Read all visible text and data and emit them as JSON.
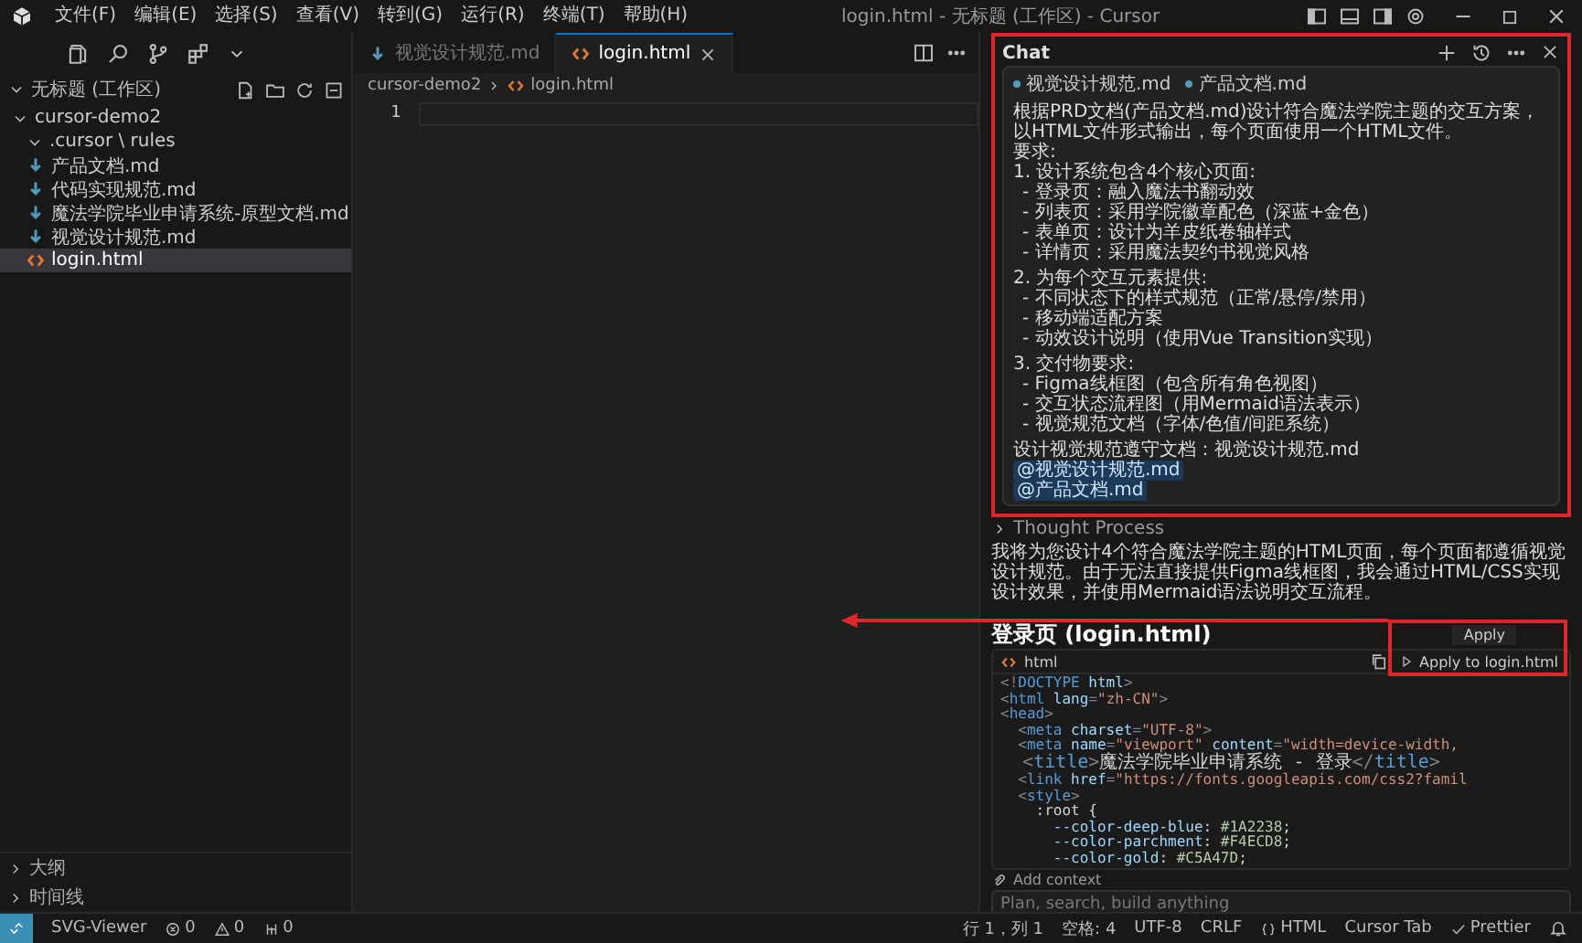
{
  "window": {
    "title": "login.html - 无标题 (工作区) - Cursor"
  },
  "menu": [
    "文件(F)",
    "编辑(E)",
    "选择(S)",
    "查看(V)",
    "转到(G)",
    "运行(R)",
    "终端(T)",
    "帮助(H)"
  ],
  "explorer": {
    "title": "无标题 (工作区)",
    "expanded": true,
    "items": [
      {
        "name": "cursor-demo2",
        "kind": "folder",
        "expanded": true,
        "selected": false,
        "children": [
          {
            "name": ".cursor \\ rules",
            "kind": "folder",
            "expanded": true,
            "selected": false
          },
          {
            "name": "产品文档.md",
            "kind": "markdown",
            "selected": false
          },
          {
            "name": "代码实现规范.md",
            "kind": "markdown",
            "selected": false
          },
          {
            "name": "魔法学院毕业申请系统-原型文档.md",
            "kind": "markdown",
            "selected": false
          },
          {
            "name": "视觉设计规范.md",
            "kind": "markdown",
            "selected": false
          },
          {
            "name": "login.html",
            "kind": "html",
            "selected": true
          }
        ]
      }
    ]
  },
  "bottom_sections": [
    {
      "label": "大纲",
      "expanded": false
    },
    {
      "label": "时间线",
      "expanded": false
    }
  ],
  "editor": {
    "tabs": [
      {
        "label": "视觉设计规范.md",
        "kind": "markdown",
        "selected": false
      },
      {
        "label": "login.html",
        "kind": "html",
        "selected": true
      }
    ],
    "breadcrumb": [
      "cursor-demo2",
      "login.html"
    ],
    "line_numbers": [
      "1"
    ]
  },
  "chat": {
    "title": "Chat",
    "context_chips": [
      "视觉设计规范.md",
      "产品文档.md"
    ],
    "message_blocks": [
      [
        {
          "kind": "text",
          "text": "根据PRD文档(产品文档.md)设计符合魔法学院主题的交互方案，以HTML文件形式输出，每个页面使用一个HTML文件。"
        },
        {
          "kind": "text",
          "text": "要求:"
        },
        {
          "kind": "text",
          "text": "1. 设计系统包含4个核心页面:"
        },
        {
          "kind": "bullet",
          "text": "- 登录页：融入魔法书翻动效"
        },
        {
          "kind": "bullet",
          "text": "- 列表页：采用学院徽章配色（深蓝+金色）"
        },
        {
          "kind": "bullet",
          "text": "- 表单页：设计为羊皮纸卷轴样式"
        },
        {
          "kind": "bullet",
          "text": "- 详情页：采用魔法契约书视觉风格"
        }
      ],
      [
        {
          "kind": "text",
          "text": "2. 为每个交互元素提供:"
        },
        {
          "kind": "bullet",
          "text": "- 不同状态下的样式规范（正常/悬停/禁用）"
        },
        {
          "kind": "bullet",
          "text": "- 移动端适配方案"
        },
        {
          "kind": "bullet",
          "text": "- 动效设计说明（使用Vue Transition实现）"
        }
      ],
      [
        {
          "kind": "text",
          "text": "3. 交付物要求:"
        },
        {
          "kind": "bullet",
          "text": "- Figma线框图（包含所有角色视图）"
        },
        {
          "kind": "bullet",
          "text": "- 交互状态流程图（用Mermaid语法表示）"
        },
        {
          "kind": "bullet",
          "text": "- 视觉规范文档（字体/色值/间距系统）"
        }
      ],
      [
        {
          "kind": "text",
          "text": "设计视觉规范遵守文档：视觉设计规范.md"
        },
        {
          "kind": "mention",
          "text": "@视觉设计规范.md"
        },
        {
          "kind": "mention",
          "text": "@产品文档.md"
        }
      ]
    ],
    "thought": {
      "label": "Thought Process",
      "expanded": false
    },
    "reply": "我将为您设计4个符合魔法学院主题的HTML页面，每个页面都遵循视觉设计规范。由于无法直接提供Figma线框图，我会通过HTML/CSS实现设计效果，并使用Mermaid语法说明交互流程。",
    "heading": "登录页 (login.html)",
    "tooltip": "Apply",
    "code": {
      "language": "html",
      "apply": "Apply to login.html",
      "lines": [
        [
          {
            "kind": "punct",
            "text": "<!"
          },
          {
            "kind": "tag",
            "text": "DOCTYPE"
          },
          {
            "kind": "attr",
            "text": " html"
          },
          {
            "kind": "punct",
            "text": ">"
          }
        ],
        [
          {
            "kind": "punct",
            "text": "<"
          },
          {
            "kind": "tag",
            "text": "html"
          },
          {
            "kind": "attr",
            "text": " lang"
          },
          {
            "kind": "punct",
            "text": "="
          },
          {
            "kind": "string",
            "text": "\"zh-CN\""
          },
          {
            "kind": "punct",
            "text": ">"
          }
        ],
        [
          {
            "kind": "punct",
            "text": "<"
          },
          {
            "kind": "tag",
            "text": "head"
          },
          {
            "kind": "punct",
            "text": ">"
          }
        ],
        [
          {
            "kind": "punct",
            "text": "  <"
          },
          {
            "kind": "tag",
            "text": "meta"
          },
          {
            "kind": "attr",
            "text": " charset"
          },
          {
            "kind": "punct",
            "text": "="
          },
          {
            "kind": "string",
            "text": "\"UTF-8\""
          },
          {
            "kind": "punct",
            "text": ">"
          }
        ],
        [
          {
            "kind": "punct",
            "text": "  <"
          },
          {
            "kind": "tag",
            "text": "meta"
          },
          {
            "kind": "attr",
            "text": " name"
          },
          {
            "kind": "punct",
            "text": "="
          },
          {
            "kind": "string",
            "text": "\"viewport\""
          },
          {
            "kind": "attr",
            "text": " content"
          },
          {
            "kind": "punct",
            "text": "="
          },
          {
            "kind": "string",
            "text": "\"width=device-width,"
          }
        ],
        [
          {
            "kind": "punct",
            "text": "  <"
          },
          {
            "kind": "tag",
            "text": "title"
          },
          {
            "kind": "punct",
            "text": ">"
          },
          {
            "kind": "plain",
            "text": "魔法学院毕业申请系统 - 登录"
          },
          {
            "kind": "punct",
            "text": "</"
          },
          {
            "kind": "tag",
            "text": "title"
          },
          {
            "kind": "punct",
            "text": ">"
          }
        ],
        [
          {
            "kind": "punct",
            "text": "  <"
          },
          {
            "kind": "tag",
            "text": "link"
          },
          {
            "kind": "attr",
            "text": " href"
          },
          {
            "kind": "punct",
            "text": "="
          },
          {
            "kind": "string",
            "text": "\"https://fonts.googleapis.com/css2?famil"
          }
        ],
        [
          {
            "kind": "punct",
            "text": "  <"
          },
          {
            "kind": "tag",
            "text": "style"
          },
          {
            "kind": "punct",
            "text": ">"
          }
        ],
        [
          {
            "kind": "plain",
            "text": "    :root {"
          }
        ],
        [
          {
            "kind": "prop",
            "text": "      --color-deep-blue"
          },
          {
            "kind": "plain",
            "text": ": "
          },
          {
            "kind": "value",
            "text": "#1A2238"
          },
          {
            "kind": "plain",
            "text": ";"
          }
        ],
        [
          {
            "kind": "prop",
            "text": "      --color-parchment"
          },
          {
            "kind": "plain",
            "text": ": "
          },
          {
            "kind": "value",
            "text": "#F4ECD8"
          },
          {
            "kind": "plain",
            "text": ";"
          }
        ],
        [
          {
            "kind": "prop",
            "text": "      --color-gold"
          },
          {
            "kind": "plain",
            "text": ": "
          },
          {
            "kind": "value",
            "text": "#C5A47D"
          },
          {
            "kind": "plain",
            "text": ";"
          }
        ]
      ]
    },
    "add_context": "Add context",
    "input": {
      "placeholder": "Plan, search, build anything"
    }
  },
  "status_bar": {
    "left": [
      {
        "kind": "plain",
        "text": "SVG-Viewer"
      },
      {
        "kind": "errors",
        "text": "0"
      },
      {
        "kind": "warnings",
        "text": "0"
      },
      {
        "kind": "ports",
        "text": "0"
      }
    ],
    "right": [
      {
        "kind": "plain",
        "text": "行 1，列 1"
      },
      {
        "kind": "plain",
        "text": "空格: 4"
      },
      {
        "kind": "plain",
        "text": "UTF-8"
      },
      {
        "kind": "plain",
        "text": "CRLF"
      },
      {
        "kind": "language",
        "text": "HTML"
      },
      {
        "kind": "plain",
        "text": "Cursor Tab"
      },
      {
        "kind": "formatter",
        "text": "Prettier"
      }
    ]
  }
}
